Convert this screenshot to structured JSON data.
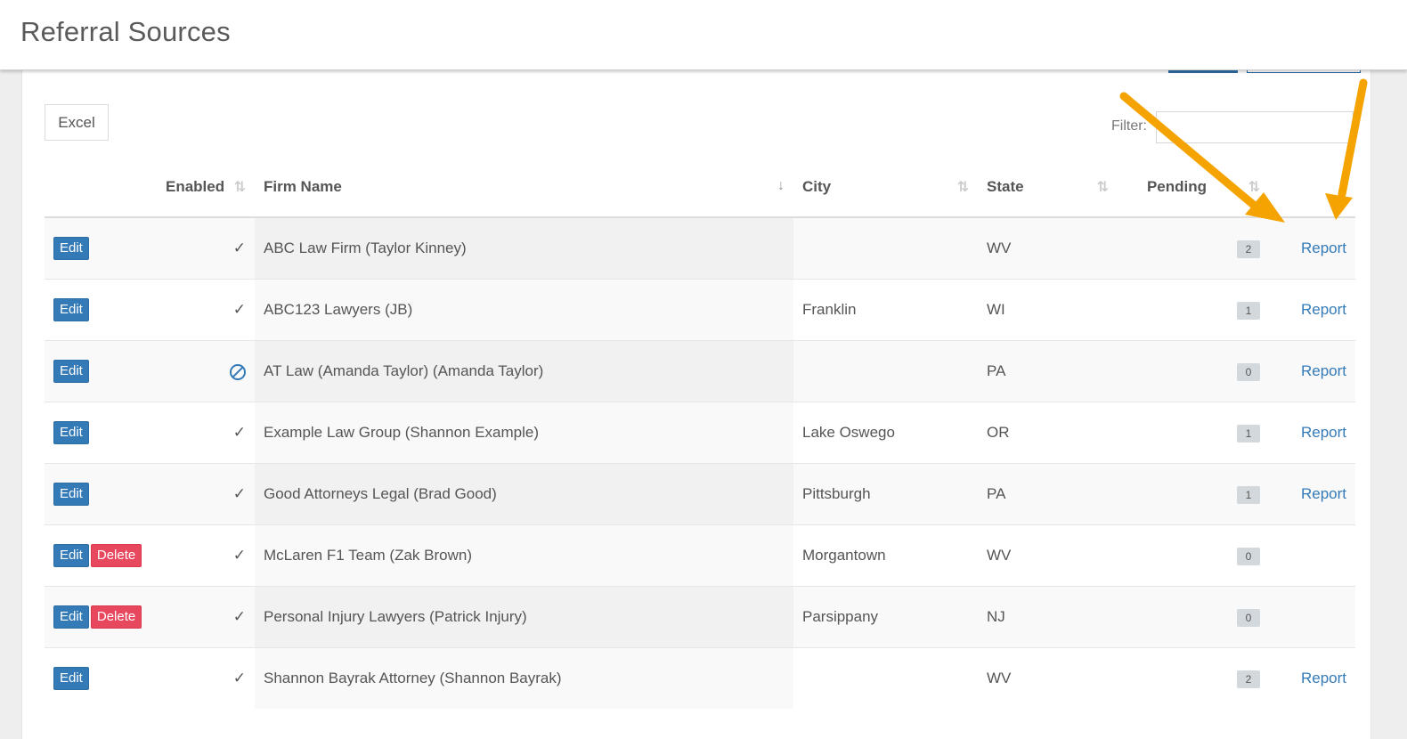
{
  "header": {
    "title": "Referral Sources"
  },
  "toolbar": {
    "excel_label": "Excel",
    "filter_label": "Filter:",
    "filter_value": ""
  },
  "columns": {
    "enabled": "Enabled",
    "firm_name": "Firm Name",
    "city": "City",
    "state": "State",
    "pending": "Pending"
  },
  "labels": {
    "edit": "Edit",
    "delete": "Delete",
    "report": "Report",
    "enabled_check": "✓"
  },
  "rows": [
    {
      "firm": "ABC Law Firm (Taylor Kinney)",
      "city": "",
      "state": "WV",
      "pending": "2",
      "enabled": "check",
      "delete": false,
      "report": true
    },
    {
      "firm": "ABC123 Lawyers (JB)",
      "city": "Franklin",
      "state": "WI",
      "pending": "1",
      "enabled": "check",
      "delete": false,
      "report": true
    },
    {
      "firm": "AT Law (Amanda Taylor) (Amanda Taylor)",
      "city": "",
      "state": "PA",
      "pending": "0",
      "enabled": "ban",
      "delete": false,
      "report": true
    },
    {
      "firm": "Example Law Group (Shannon Example)",
      "city": "Lake Oswego",
      "state": "OR",
      "pending": "1",
      "enabled": "check",
      "delete": false,
      "report": true
    },
    {
      "firm": "Good Attorneys Legal (Brad Good)",
      "city": "Pittsburgh",
      "state": "PA",
      "pending": "1",
      "enabled": "check",
      "delete": false,
      "report": true
    },
    {
      "firm": "McLaren F1 Team (Zak Brown)",
      "city": "Morgantown",
      "state": "WV",
      "pending": "0",
      "enabled": "check",
      "delete": true,
      "report": false
    },
    {
      "firm": "Personal Injury Lawyers (Patrick Injury)",
      "city": "Parsippany",
      "state": "NJ",
      "pending": "0",
      "enabled": "check",
      "delete": true,
      "report": false
    },
    {
      "firm": "Shannon Bayrak Attorney (Shannon Bayrak)",
      "city": "",
      "state": "WV",
      "pending": "2",
      "enabled": "check",
      "delete": false,
      "report": true
    }
  ],
  "colors": {
    "primary": "#337ab7",
    "danger": "#e8485e",
    "badge": "#d3d8dc",
    "annotation_arrow": "#f5a300"
  }
}
